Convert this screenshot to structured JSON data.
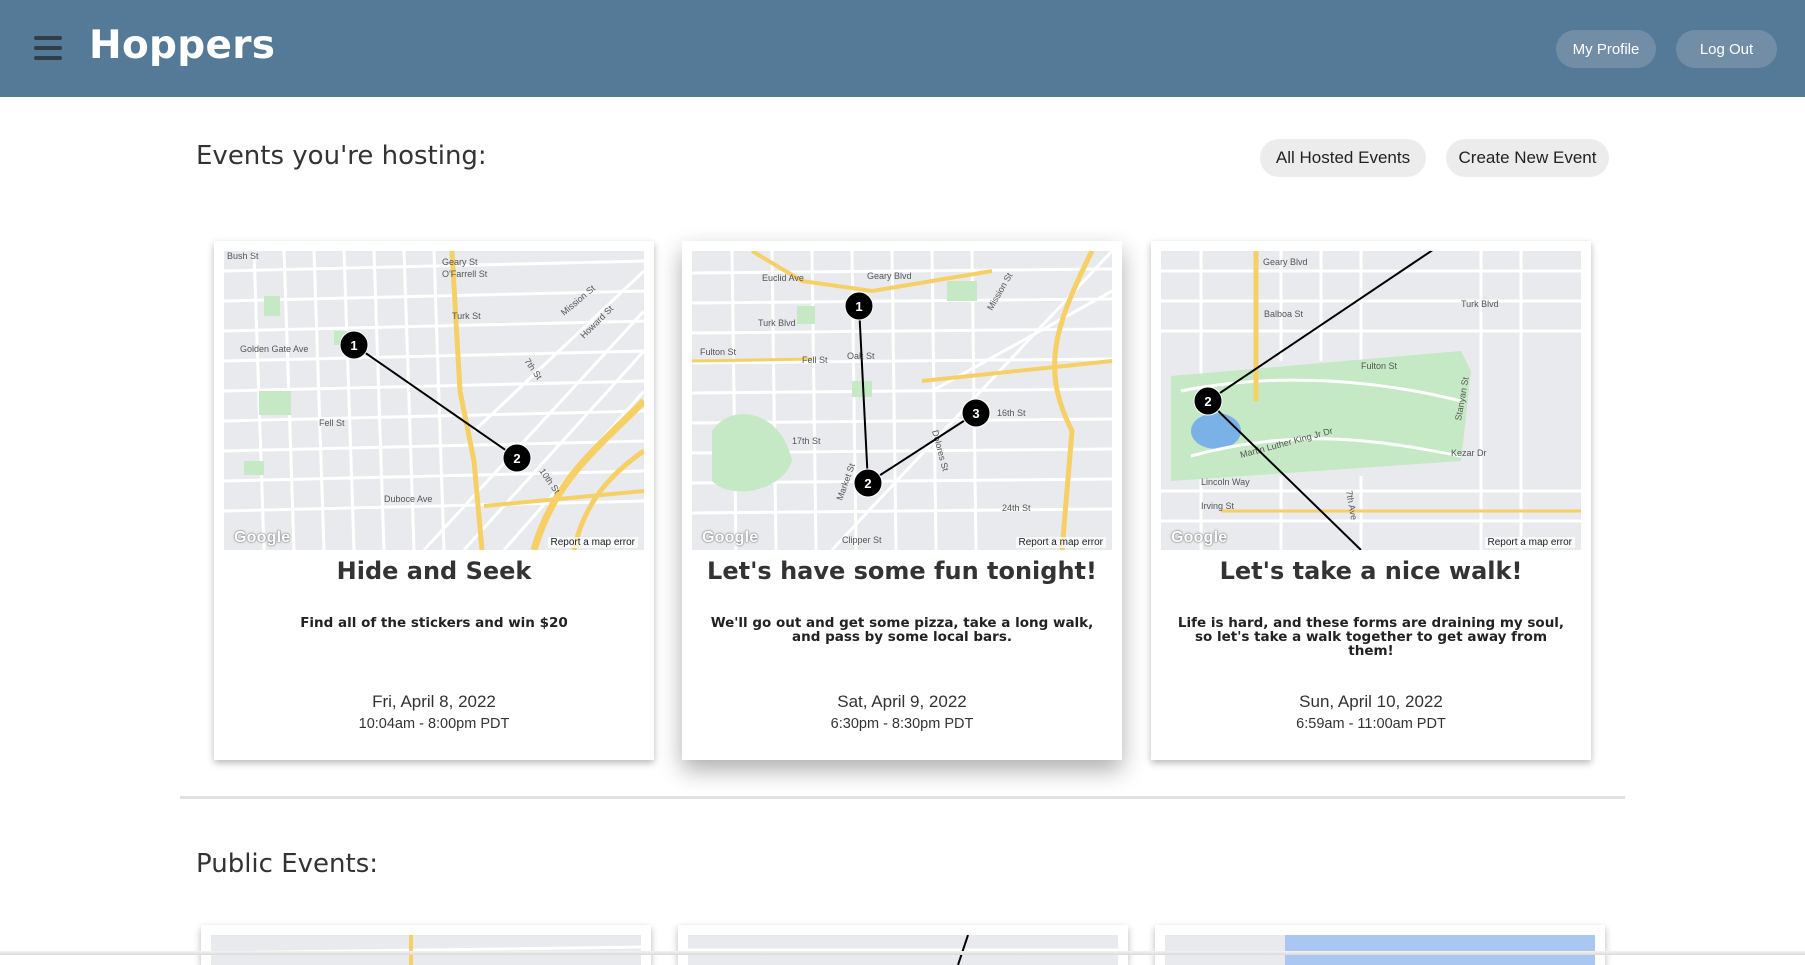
{
  "header": {
    "brand": "Hoppers",
    "profile_label": "My Profile",
    "logout_label": "Log Out",
    "menu_icon": "hamburger-menu-icon",
    "bg_color": "#557a98"
  },
  "hosting": {
    "title": "Events you're hosting:",
    "all_label": "All Hosted Events",
    "create_label": "Create New Event",
    "events": [
      {
        "title": "Hide and Seek",
        "description": "Find all of the stickers and win $20",
        "date": "Fri, April 8, 2022",
        "time": "10:04am - 8:00pm PDT",
        "stops": [
          "1",
          "2"
        ]
      },
      {
        "title": "Let's have some fun tonight!",
        "description": "We'll go out and get some pizza, take a long walk, and pass by some local bars.",
        "date": "Sat, April 9, 2022",
        "time": "6:30pm - 8:30pm PDT",
        "stops": [
          "1",
          "2",
          "3"
        ]
      },
      {
        "title": "Let's take a nice walk!",
        "description": "Life is hard, and these forms are draining my soul, so let's take a walk together to get away from them!",
        "date": "Sun, April 10, 2022",
        "time": "6:59am - 11:00am PDT",
        "stops": [
          "2"
        ]
      }
    ]
  },
  "public": {
    "title": "Public Events:"
  },
  "map": {
    "attribution": "Report a map error",
    "logo": "Google",
    "labels_1": [
      "Bush St",
      "Geary St",
      "O'Farrell St",
      "Turk St",
      "Golden Gate Ave",
      "Fell St",
      "Mission St",
      "Howard St",
      "7th St",
      "10th St",
      "Duboce Ave"
    ],
    "labels_2": [
      "Euclid Ave",
      "Geary Blvd",
      "Turk Blvd",
      "Fulton St",
      "Fell St",
      "Oak St",
      "17th St",
      "Market St",
      "Dolores St",
      "16th St",
      "24th St",
      "Clipper St",
      "Mission St"
    ],
    "labels_3": [
      "Geary Blvd",
      "Balboa St",
      "Fulton St",
      "Turk Blvd",
      "Lincoln Way",
      "Irving St",
      "Martin Luther King Jr Dr",
      "Kezar Dr",
      "7th Ave",
      "Stanyan St"
    ]
  },
  "colors": {
    "map_bg": "#e8eaed",
    "road_main": "#f6cf65",
    "park": "#c5e8c5",
    "marker": "#000000"
  }
}
